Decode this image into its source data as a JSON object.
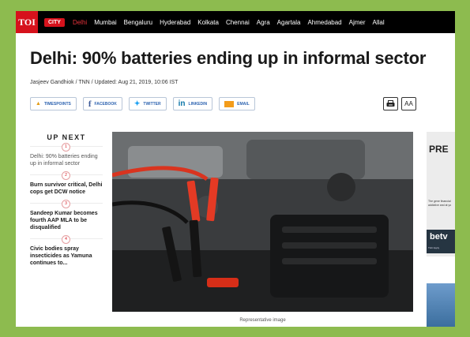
{
  "topnav": {
    "logo": "TOI",
    "city_badge": "CITY",
    "items": [
      {
        "label": "Delhi",
        "active": true
      },
      {
        "label": "Mumbai"
      },
      {
        "label": "Bengaluru"
      },
      {
        "label": "Hyderabad"
      },
      {
        "label": "Kolkata"
      },
      {
        "label": "Chennai"
      },
      {
        "label": "Agra"
      },
      {
        "label": "Agartala"
      },
      {
        "label": "Ahmedabad"
      },
      {
        "label": "Ajmer"
      },
      {
        "label": "Allal"
      }
    ]
  },
  "article": {
    "headline": "Delhi: 90% batteries ending up in informal sector",
    "byline": "Jasjeev Gandhiok / TNN / Updated: Aug 21, 2019, 10:06 IST",
    "image_caption": "Representative image"
  },
  "share": {
    "timespoints": "TIMESPOINTS",
    "facebook": "FACEBOOK",
    "twitter": "TWITTER",
    "linkedin": "LINKEDIN",
    "email": "EMAIL",
    "font_size_label": "AA"
  },
  "upnext": {
    "title": "UP NEXT",
    "items": [
      {
        "num": "1",
        "text": "Delhi: 90% batteries ending up in informal sector"
      },
      {
        "num": "2",
        "text": "Burn survivor critical, Delhi cops get DCW notice"
      },
      {
        "num": "3",
        "text": "Sandeep Kumar becomes fourth AAP MLA to be disqualified"
      },
      {
        "num": "4",
        "text": "Civic bodies spray insecticides as Yamuna continues to..."
      }
    ]
  },
  "ad": {
    "title": "PRE",
    "text": "The gene financial addictive and at yo",
    "logo": "betv",
    "small": "T&C Apply"
  },
  "colors": {
    "brand_red": "#d6121c",
    "frame_green": "#8dbb4f",
    "nav_black": "#000000"
  }
}
